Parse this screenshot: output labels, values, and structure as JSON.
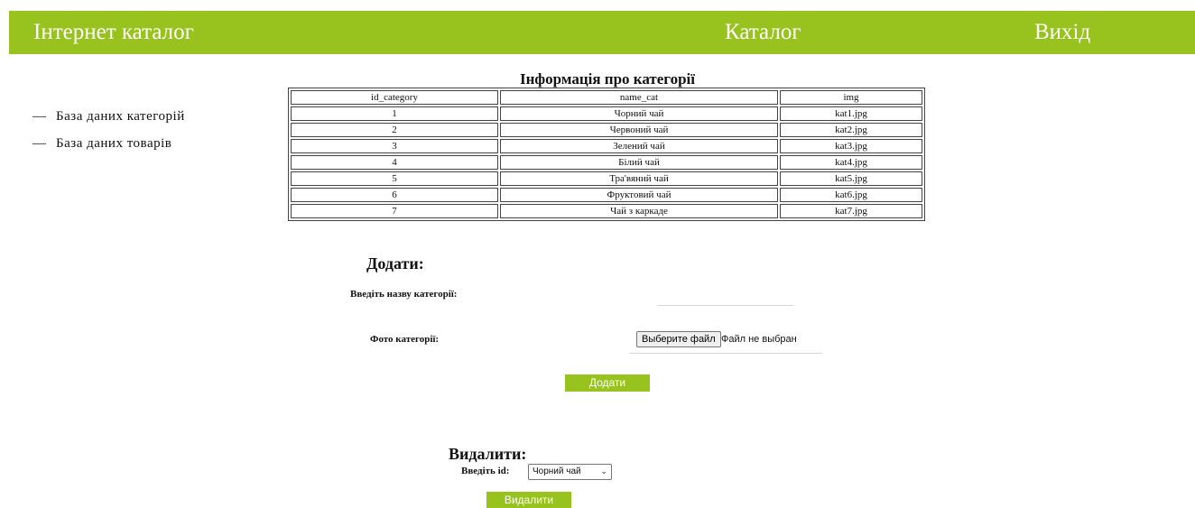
{
  "header": {
    "brand": "Інтернет каталог",
    "catalog_link": "Каталог",
    "exit_link": "Вихід",
    "color": "#98c31e"
  },
  "sidebar": {
    "items": [
      {
        "dash": "—",
        "label": "База даних категорій"
      },
      {
        "dash": "—",
        "label": "База даних товарів"
      }
    ]
  },
  "table": {
    "title": "Інформація про категорії",
    "columns": [
      "id_category",
      "name_cat",
      "img"
    ],
    "rows": [
      [
        "1",
        "Чорний чай",
        "kat1.jpg"
      ],
      [
        "2",
        "Червоний чай",
        "kat2.jpg"
      ],
      [
        "3",
        "Зелений чай",
        "kat3.jpg"
      ],
      [
        "4",
        "Білий чай",
        "kat4.jpg"
      ],
      [
        "5",
        "Тра'вяний чай",
        "kat5.jpg"
      ],
      [
        "6",
        "Фруктовий чай",
        "kat6.jpg"
      ],
      [
        "7",
        "Чай з каркаде",
        "kat7.jpg"
      ]
    ]
  },
  "add_form": {
    "title": "Додати:",
    "name_label": "Введіть назву категорії:",
    "name_value": "",
    "photo_label": "Фото категорії:",
    "file_button": "Выберите файл",
    "file_status": "Файл не выбран",
    "submit": "Додати"
  },
  "delete_form": {
    "title": "Видалити:",
    "id_label": "Введіть id:",
    "selected": "Чорний чай",
    "submit": "Видалити"
  }
}
